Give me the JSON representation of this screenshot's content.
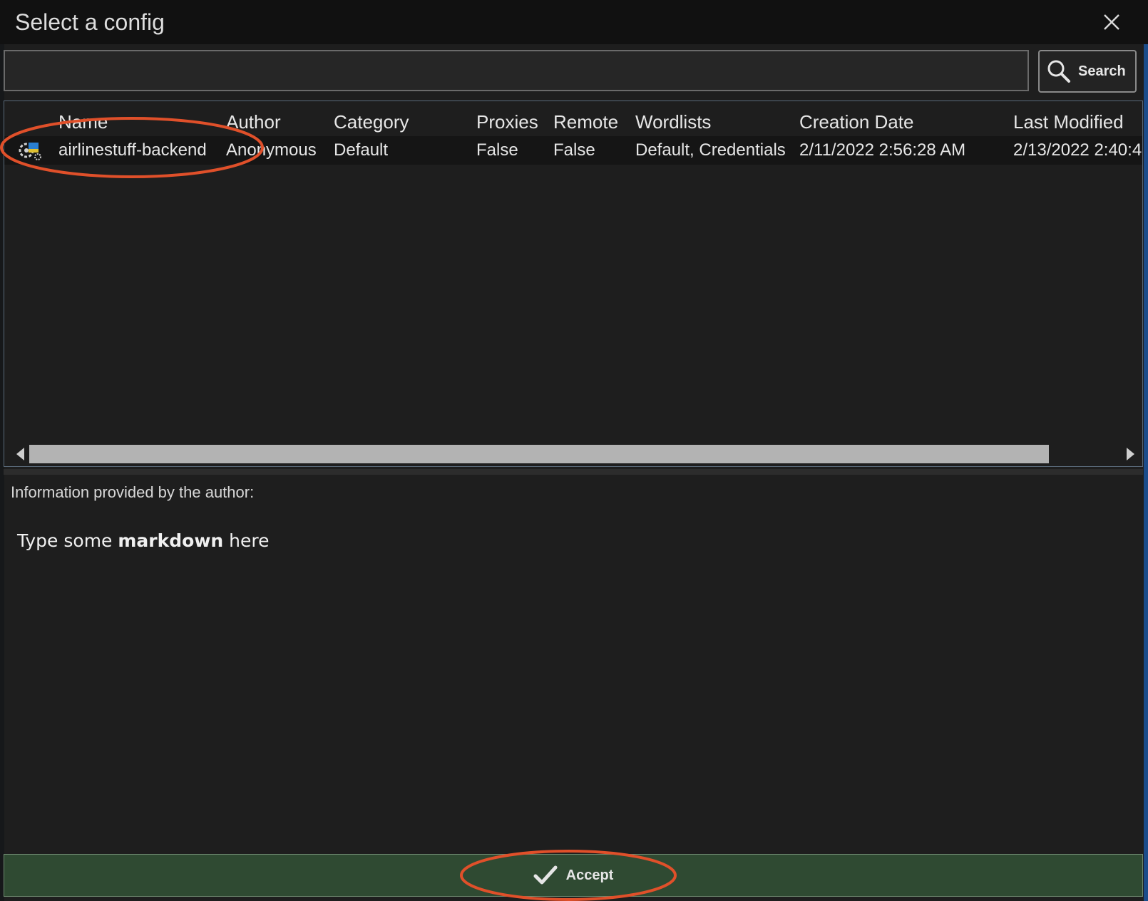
{
  "window": {
    "title": "Select a config"
  },
  "search": {
    "value": "",
    "button_label": "Search"
  },
  "table": {
    "columns": [
      "Name",
      "Author",
      "Category",
      "Proxies",
      "Remote",
      "Wordlists",
      "Creation Date",
      "Last Modified"
    ],
    "rows": [
      {
        "name": "airlinestuff-backend",
        "author": "Anonymous",
        "category": "Default",
        "proxies": "False",
        "remote": "False",
        "wordlists": "Default, Credentials",
        "creation_date": "2/11/2022 2:56:28 AM",
        "last_modified": "2/13/2022 2:40:4"
      }
    ]
  },
  "info": {
    "label": "Information provided by the author:",
    "text_before": "Type some ",
    "text_bold": "markdown",
    "text_after": " here"
  },
  "actions": {
    "accept_label": "Accept"
  },
  "colors": {
    "background": "#1e1e1e",
    "titlebar": "#111111",
    "accept_bar": "#2f4a32",
    "annotation": "#e0502a"
  },
  "icons": [
    "close-icon",
    "search-icon",
    "config-icon",
    "arrow-left-icon",
    "arrow-right-icon",
    "check-icon"
  ]
}
